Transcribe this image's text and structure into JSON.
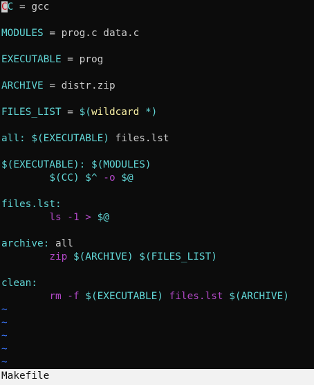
{
  "colors": {
    "background": "#0c0c0c",
    "keyword_cyan": "#61d6d6",
    "plain_text": "#cccccc",
    "function_yellow": "#f9f1a5",
    "command_magenta": "#b148c6",
    "tilde_blue": "#3b78ff",
    "status_bar": "#f2f2f2"
  },
  "editor": {
    "cursor_char": "C",
    "line1": {
      "var_rest": "C",
      "op": " = ",
      "value": "gcc"
    },
    "line3": {
      "var": "MODULES",
      "op": " = ",
      "value": "prog.c data.c"
    },
    "line5": {
      "var": "EXECUTABLE",
      "op": " = ",
      "value": "prog"
    },
    "line7": {
      "var": "ARCHIVE",
      "op": " = ",
      "value": "distr.zip"
    },
    "line9": {
      "var": "FILES_LIST",
      "op": " = ",
      "open": "$(",
      "func": "wildcard",
      "arg": " *)"
    },
    "line11": {
      "target": "all:",
      "deps": " $(EXECUTABLE)",
      "rest": " files.lst"
    },
    "line13": {
      "target": "$(EXECUTABLE):",
      "deps": " $(MODULES)"
    },
    "line14": {
      "indent": "        ",
      "vars": "$(CC) $^",
      "cmd": " -o",
      "auto": " $@"
    },
    "line16": {
      "target": "files.lst:"
    },
    "line17": {
      "indent": "        ",
      "cmd": "ls -1 >",
      "auto": " $@"
    },
    "line19": {
      "target": "archive:",
      "rest": " all"
    },
    "line20": {
      "indent": "        ",
      "cmd": "zip",
      "vars": " $(ARCHIVE) $(FILES_LIST)"
    },
    "line22": {
      "target": "clean:"
    },
    "line23": {
      "indent": "        ",
      "cmd": "rm -f",
      "var1": " $(EXECUTABLE)",
      "cmd2": " files.lst",
      "var2": " $(ARCHIVE)"
    },
    "tilde": "~"
  },
  "status_bar": {
    "filename": "Makefile"
  }
}
